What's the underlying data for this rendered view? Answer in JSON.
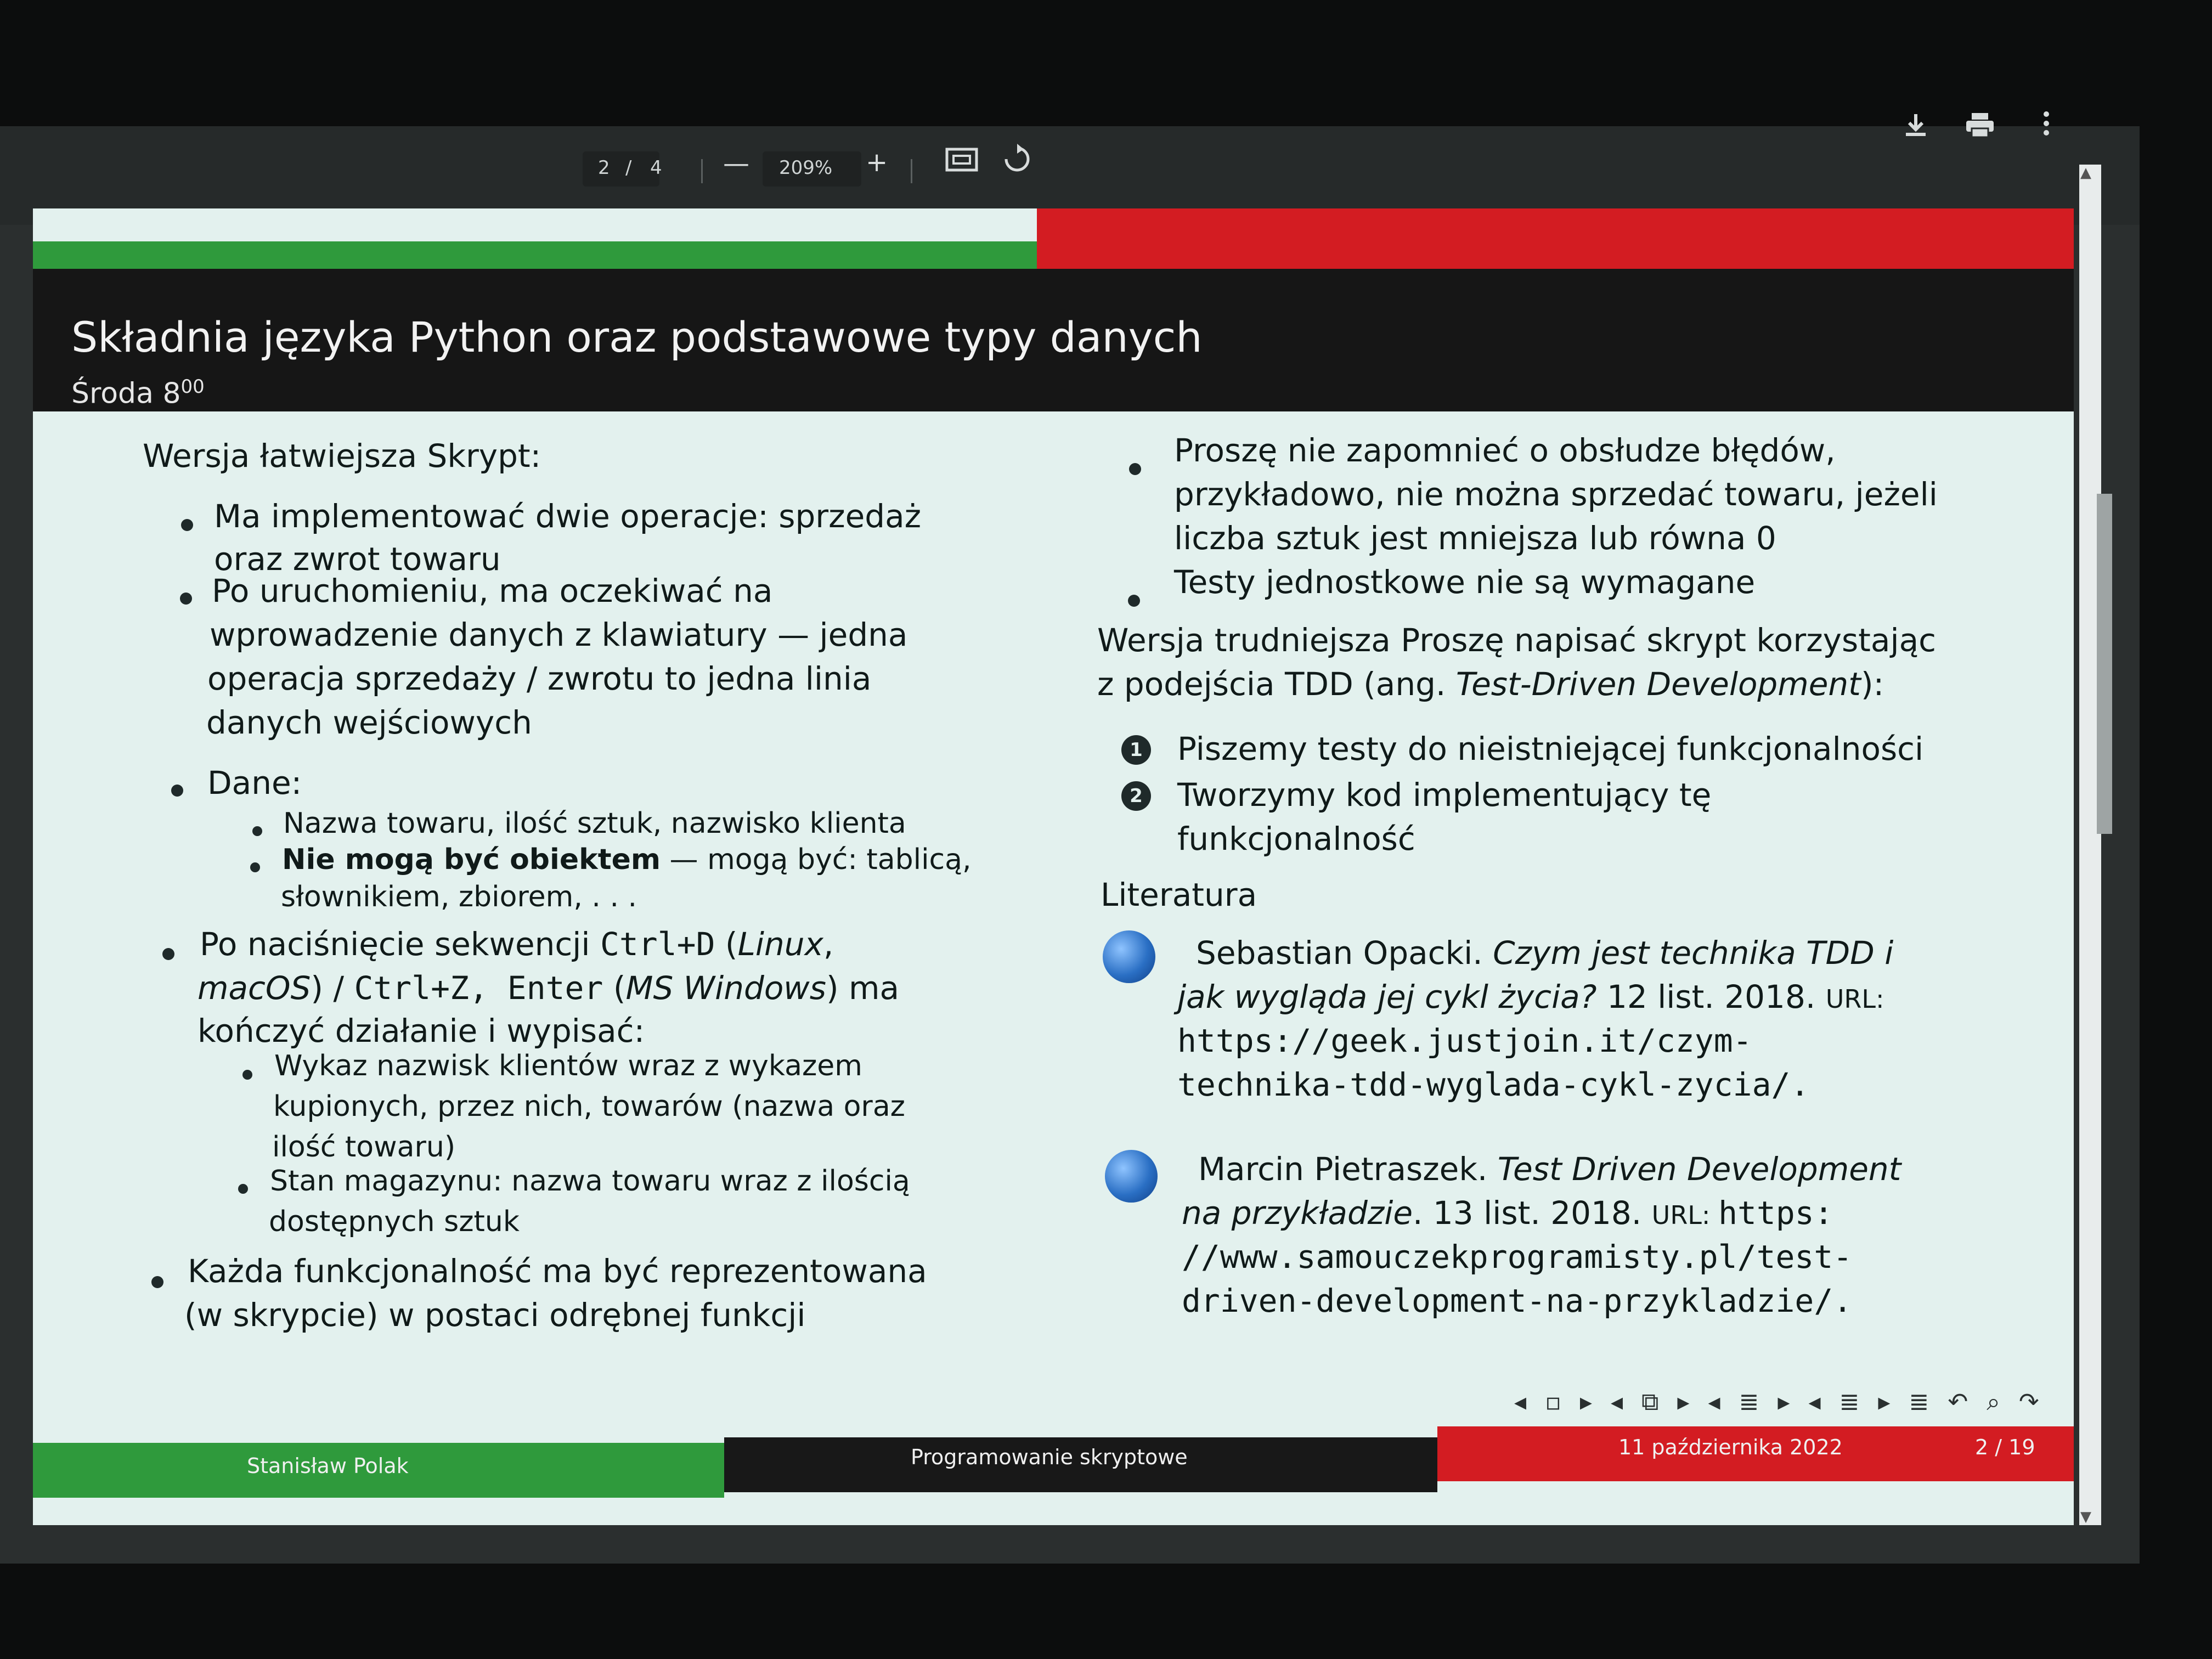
{
  "toolbar": {
    "page_current": "2",
    "page_sep": "/",
    "page_total": "4",
    "zoom_out": "—",
    "zoom_level": "209%",
    "zoom_in": "+",
    "download_icon": "download-icon",
    "print_icon": "print-icon",
    "more_icon": "more-vert-icon"
  },
  "slide": {
    "title": "Składnia języka Python oraz podstawowe typy danych",
    "subtitle": "Środa 8",
    "subtitle_sup": "00",
    "left": {
      "heading": "Wersja łatwiejsza Skrypt:",
      "b1_l1": "Ma implementować dwie operacje: sprzedaż",
      "b1_l2": "oraz zwrot towaru",
      "b2_l1": "Po uruchomieniu, ma oczekiwać na",
      "b2_l2": "wprowadzenie danych z klawiatury — jedna",
      "b2_l3": "operacja sprzedaży / zwrotu to jedna linia",
      "b2_l4": "danych wejściowych",
      "b3": "Dane:",
      "b3a": "Nazwa towaru, ilość sztuk, nazwisko klienta",
      "b3b_bold": "Nie mogą być obiektem",
      "b3b_rest": " — mogą być: tablicą,",
      "b3b_l2": "słownikiem, zbiorem, . . .",
      "b4_l1_a": "Po naciśnięcie sekwencji ",
      "b4_l1_code": "Ctrl+D",
      "b4_l1_b": " (",
      "b4_l1_it": "Linux",
      "b4_l1_c": ",",
      "b4_l2_it": "macOS",
      "b4_l2_a": ") / ",
      "b4_l2_code": "Ctrl+Z, Enter",
      "b4_l2_b": " (",
      "b4_l2_it2": "MS Windows",
      "b4_l2_c": ") ma",
      "b4_l3": "kończyć działanie i wypisać:",
      "b4a_l1": "Wykaz nazwisk klientów wraz z wykazem",
      "b4a_l2": "kupionych, przez nich, towarów (nazwa oraz",
      "b4a_l3": "ilość towaru)",
      "b4b_l1": "Stan magazynu: nazwa towaru wraz z ilością",
      "b4b_l2": "dostępnych sztuk",
      "b5_l1": "Każda funkcjonalność ma być reprezentowana",
      "b5_l2": "(w skrypcie) w postaci odrębnej funkcji"
    },
    "right": {
      "r1_l1": "Proszę nie zapomnieć o obsłudze błędów,",
      "r1_l2": "przykładowo, nie można sprzedać towaru, jeżeli",
      "r1_l3": "liczba sztuk jest mniejsza lub równa 0",
      "r2": "Testy jednostkowe nie są wymagane",
      "hard_l1": "Wersja trudniejsza Proszę napisać skrypt korzystając",
      "hard_l2_a": "z podejścia TDD (ang. ",
      "hard_l2_it": "Test-Driven Development",
      "hard_l2_b": "):",
      "n1_num": "1",
      "n1": "Piszemy testy do nieistniejącej funkcjonalności",
      "n2_num": "2",
      "n2_l1": "Tworzymy kod implementujący tę",
      "n2_l2": "funkcjonalność",
      "lit_heading": "Literatura",
      "ref1_l1_a": "Sebastian Opacki. ",
      "ref1_l1_it": "Czym jest technika TDD i",
      "ref1_l2_it": "jak wygląda jej cykl życia?",
      "ref1_l2_b": " 12 list. 2018. ",
      "ref1_l2_url": "URL:",
      "ref1_l3": "https://geek.justjoin.it/czym-",
      "ref1_l4": "technika-tdd-wyglada-cykl-zycia/.",
      "ref2_l1_a": "Marcin Pietraszek. ",
      "ref2_l1_it": "Test Driven Development",
      "ref2_l2_it": "na przykładzie",
      "ref2_l2_b": ". 13 list. 2018. ",
      "ref2_l2_url": "URL: ",
      "ref2_l2_code": "https:",
      "ref2_l3": "//www.samouczekprogramisty.pl/test-",
      "ref2_l4": "driven-development-na-przykladzie/."
    },
    "nav_symbols": "◂ ▫ ▸ ◂ ⧉ ▸ ◂ ≣ ▸ ◂ ≣ ▸  ≣  ↶ ⌕ ↷",
    "footer": {
      "author": "Stanisław Polak",
      "course": "Programowanie skryptowe",
      "date": "11 października 2022",
      "page": "2 / 19"
    }
  }
}
